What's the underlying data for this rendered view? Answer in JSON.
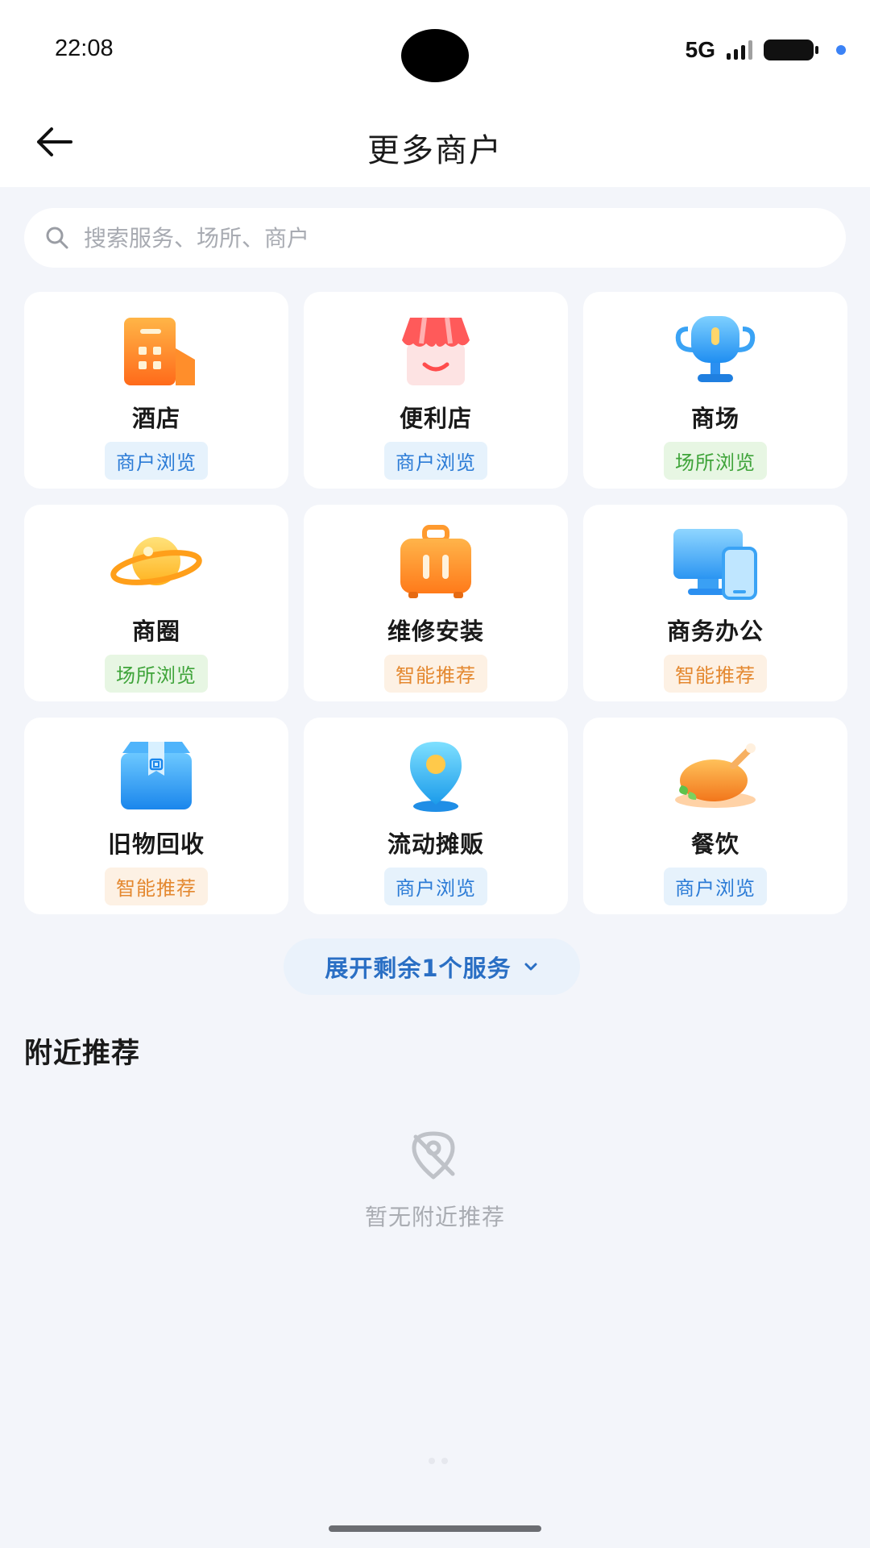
{
  "status_bar": {
    "time": "22:08",
    "network": "5G"
  },
  "nav": {
    "title": "更多商户"
  },
  "search": {
    "placeholder": "搜索服务、场所、商户"
  },
  "categories": [
    {
      "label": "酒店",
      "tag": "商户浏览",
      "icon": "hotel-building-icon"
    },
    {
      "label": "便利店",
      "tag": "商户浏览",
      "icon": "convenience-store-icon"
    },
    {
      "label": "商场",
      "tag": "场所浏览",
      "icon": "trophy-mall-icon"
    },
    {
      "label": "商圈",
      "tag": "场所浏览",
      "icon": "planet-icon"
    },
    {
      "label": "维修安装",
      "tag": "智能推荐",
      "icon": "toolbox-icon"
    },
    {
      "label": "商务办公",
      "tag": "智能推荐",
      "icon": "computer-phone-icon"
    },
    {
      "label": "旧物回收",
      "tag": "智能推荐",
      "icon": "recycle-box-icon"
    },
    {
      "label": "流动摊贩",
      "tag": "商户浏览",
      "icon": "location-pin-icon"
    },
    {
      "label": "餐饮",
      "tag": "商户浏览",
      "icon": "roast-chicken-icon"
    }
  ],
  "expand": {
    "label": "展开剩余1个服务"
  },
  "nearby": {
    "title": "附近推荐",
    "empty_text": "暂无附近推荐"
  },
  "colors": {
    "tag_blue": "#2b7bd6",
    "tag_green": "#3fa43a",
    "tag_orange": "#e4882f",
    "link_blue": "#2a6fc4"
  }
}
